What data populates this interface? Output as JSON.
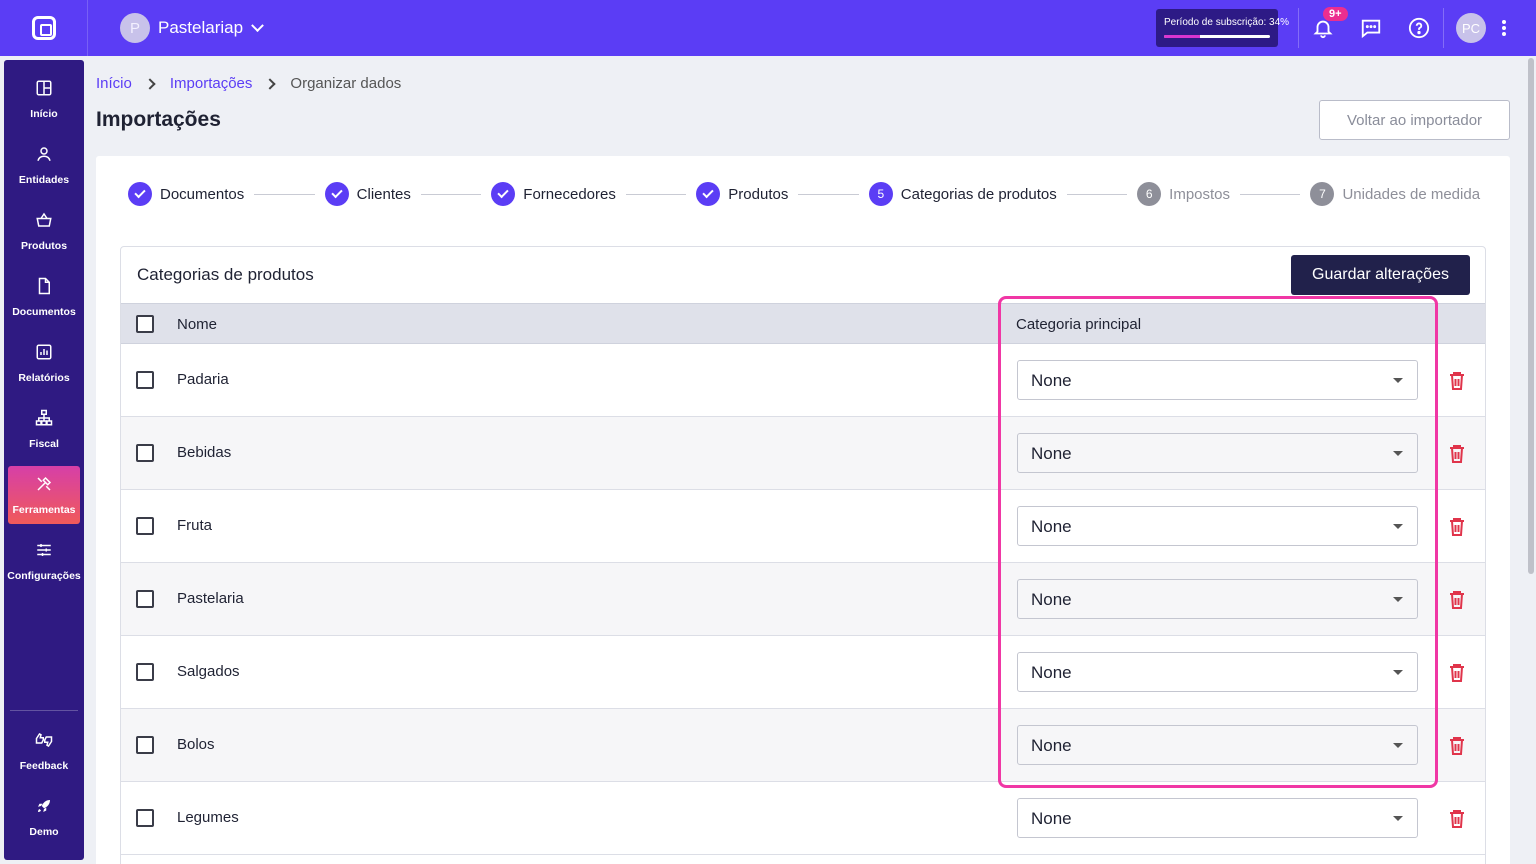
{
  "topbar": {
    "company_initial": "P",
    "company_name": "Pastelariap",
    "subscription_label": "Período de subscrição: 34%",
    "subscription_progress": 0.34,
    "notif_badge": "9+",
    "user_initials": "PC"
  },
  "sidebar": {
    "items": [
      {
        "label": "Início",
        "icon": "grid-icon"
      },
      {
        "label": "Entidades",
        "icon": "person-icon"
      },
      {
        "label": "Produtos",
        "icon": "basket-icon"
      },
      {
        "label": "Documentos",
        "icon": "document-icon"
      },
      {
        "label": "Relatórios",
        "icon": "chart-icon"
      },
      {
        "label": "Fiscal",
        "icon": "fiscal-icon"
      },
      {
        "label": "Ferramentas",
        "icon": "tools-icon"
      },
      {
        "label": "Configurações",
        "icon": "sliders-icon"
      }
    ],
    "bottom_items": [
      {
        "label": "Feedback",
        "icon": "feedback-icon"
      },
      {
        "label": "Demo",
        "icon": "rocket-icon"
      }
    ],
    "active": "Ferramentas"
  },
  "breadcrumb": {
    "items": [
      "Início",
      "Importações"
    ],
    "current": "Organizar dados"
  },
  "page_title": "Importações",
  "back_button": "Voltar ao importador",
  "stepper": {
    "steps": [
      {
        "label": "Documentos",
        "state": "done",
        "num": ""
      },
      {
        "label": "Clientes",
        "state": "done",
        "num": ""
      },
      {
        "label": "Fornecedores",
        "state": "done",
        "num": ""
      },
      {
        "label": "Produtos",
        "state": "done",
        "num": ""
      },
      {
        "label": "Categorias de produtos",
        "state": "current",
        "num": "5"
      },
      {
        "label": "Impostos",
        "state": "pending",
        "num": "6"
      },
      {
        "label": "Unidades de medida",
        "state": "pending",
        "num": "7"
      }
    ]
  },
  "table": {
    "title": "Categorias de produtos",
    "save_label": "Guardar alterações",
    "col_name": "Nome",
    "col_category": "Categoria principal",
    "rows": [
      {
        "name": "Padaria",
        "category": "None"
      },
      {
        "name": "Bebidas",
        "category": "None"
      },
      {
        "name": "Fruta",
        "category": "None"
      },
      {
        "name": "Pastelaria",
        "category": "None"
      },
      {
        "name": "Salgados",
        "category": "None"
      },
      {
        "name": "Bolos",
        "category": "None"
      },
      {
        "name": "Legumes",
        "category": "None"
      }
    ]
  },
  "colors": {
    "brand": "#5b3df5",
    "sidebar": "#2f1a82",
    "highlight": "#f037a5",
    "delete": "#e0344b"
  }
}
